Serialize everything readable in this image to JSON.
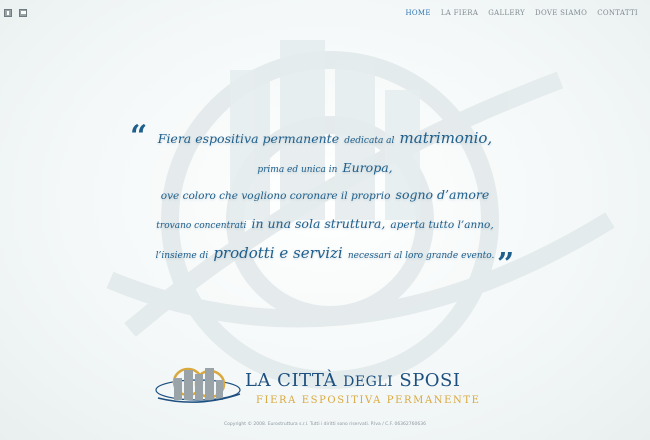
{
  "nav": {
    "items": [
      {
        "label": "HOME",
        "active": true
      },
      {
        "label": "LA FIERA",
        "active": false
      },
      {
        "label": "GALLERY",
        "active": false
      },
      {
        "label": "DOVE SIAMO",
        "active": false
      },
      {
        "label": "CONTATTI",
        "active": false
      }
    ]
  },
  "view_toggles": [
    {
      "icon": "grid-view-icon"
    },
    {
      "icon": "single-view-icon"
    }
  ],
  "quote": {
    "open_mark": "“",
    "close_mark": "”",
    "line1": {
      "a": "Fiera espositiva permanente",
      "b": "dedicata al",
      "c": "matrimonio,"
    },
    "line2": {
      "a": "prima ed unica in",
      "b": "Europa,"
    },
    "line3": {
      "a": "ove coloro che vogliono coronare il proprio",
      "b": "sogno d’amore"
    },
    "line4": {
      "a": "trovano concentrati",
      "b": "in una sola struttura,",
      "c": "aperta tutto l’anno,"
    },
    "line5": {
      "a": "l’insieme di",
      "b": "prodotti e servizi",
      "c": "necessari al loro grande evento."
    }
  },
  "logo": {
    "title_1": "LA CITTÀ",
    "title_2": "DEGLI",
    "title_3": "SPOSI",
    "subtitle": "FIERA ESPOSITIVA PERMANENTE"
  },
  "footer": {
    "text": "Copyright © 2008. Eurostruttura s.r.l.  Tutti i diritti sono riservati. P.Iva / C.F. 06362760636"
  },
  "colors": {
    "accent": "#2d76b3",
    "quote_text": "#1f5f8c",
    "logo_blue": "#1d4f7f",
    "logo_gold": "#d9a93e"
  }
}
